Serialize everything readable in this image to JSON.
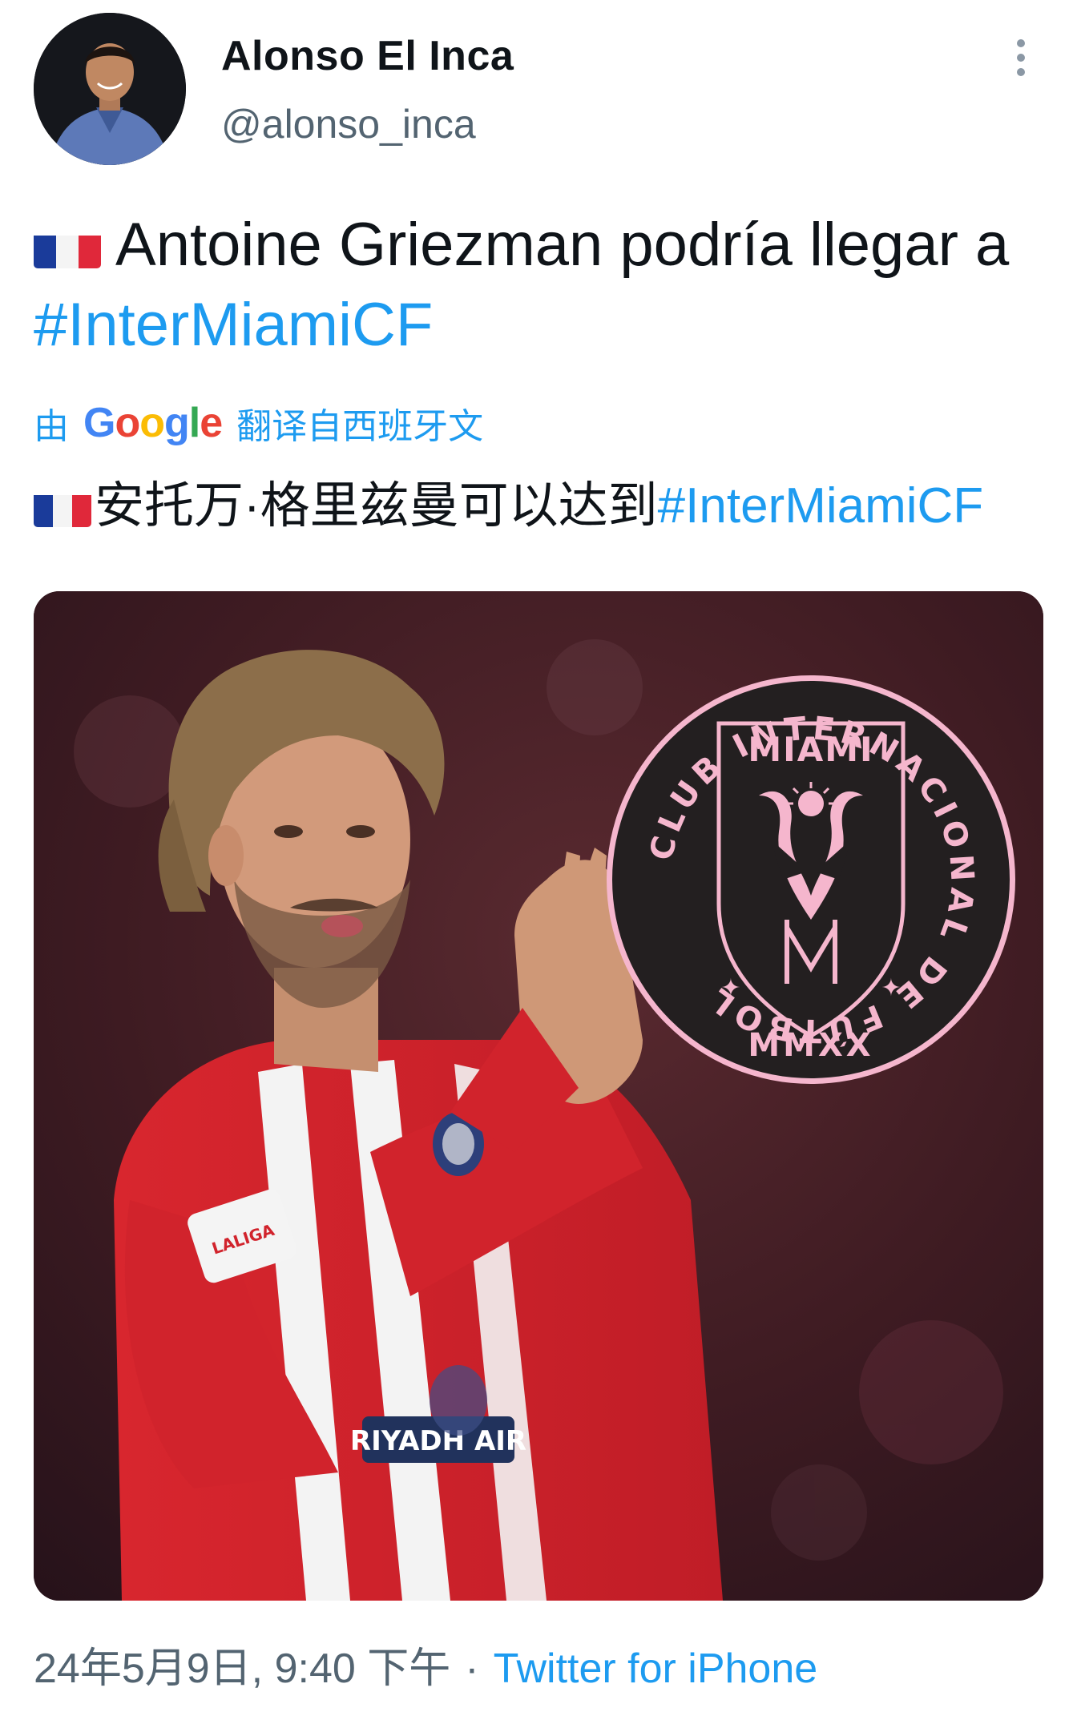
{
  "author": {
    "display_name": "Alonso El Inca",
    "handle": "@alonso_inca"
  },
  "tweet": {
    "text_main": "Antoine Griezman podría llegar a ",
    "hashtag": "#InterMiamiCF",
    "flag_icon": "france-flag-icon"
  },
  "translation": {
    "prefix": "由",
    "google_label": "Google",
    "suffix": "翻译自西班牙文",
    "text": "安托万·格里兹曼可以达到",
    "hashtag": "#InterMiamiCF"
  },
  "media": {
    "logo": {
      "ring_text": "CLUB INTERNACIONAL DE FÚTBOL",
      "title": "MIAMI",
      "year": "MMXX"
    },
    "jersey_sponsor": "RIYADH AIR",
    "league_patch": "LALIGA"
  },
  "meta": {
    "timestamp": "24年5月9日, 9:40 下午",
    "separator": "·",
    "source": "Twitter for iPhone"
  },
  "colors": {
    "link": "#1d9bf0",
    "secondary_text": "#536471",
    "logo_pink": "#f5b6cd",
    "logo_black": "#231f20"
  }
}
